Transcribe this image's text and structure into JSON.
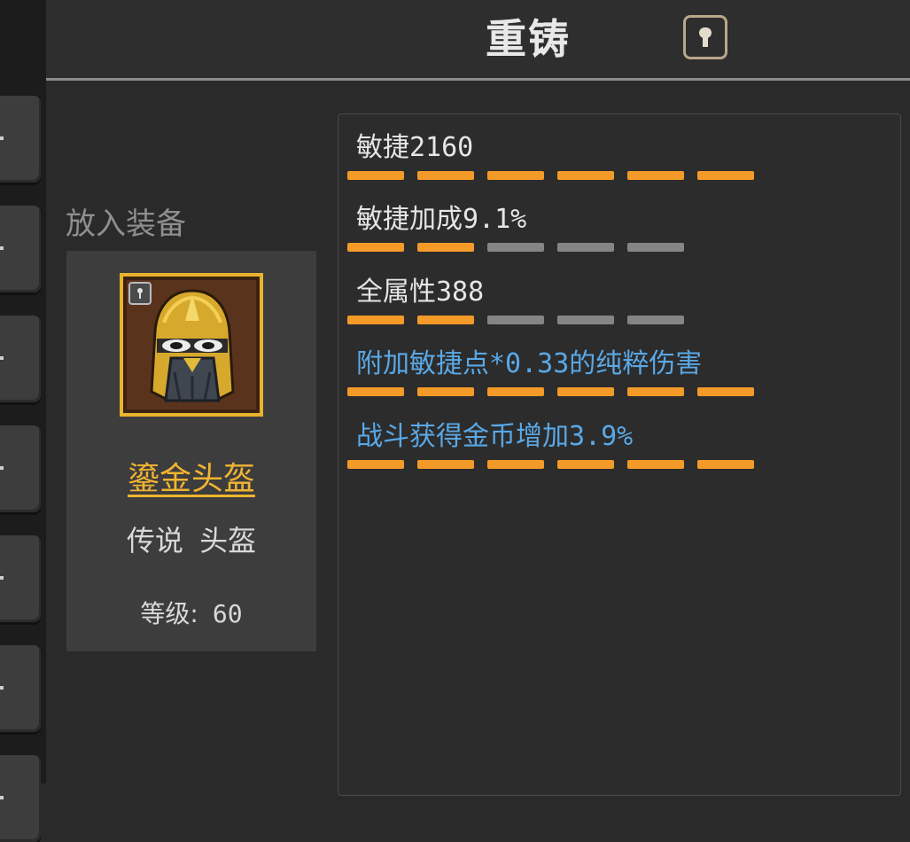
{
  "header": {
    "title": "重铸"
  },
  "slot": {
    "label": "放入装备"
  },
  "item": {
    "name": "鎏金头盔",
    "type": "传说 头盔",
    "level_label": "等级:",
    "level_value": "60"
  },
  "stats": [
    {
      "text": "敏捷2160",
      "special": false,
      "tier_filled": 6,
      "tier_max": 6
    },
    {
      "text": "敏捷加成9.1%",
      "special": false,
      "tier_filled": 2,
      "tier_max": 5
    },
    {
      "text": "全属性388",
      "special": false,
      "tier_filled": 2,
      "tier_max": 5
    },
    {
      "text": "附加敏捷点*0.33的纯粹伤害",
      "special": true,
      "tier_filled": 6,
      "tier_max": 6
    },
    {
      "text": "战斗获得金币增加3.9%",
      "special": true,
      "tier_filled": 6,
      "tier_max": 6
    }
  ],
  "colors": {
    "background": "#2a2a2a",
    "title": "#e8e8e8",
    "item_legendary": "#f0b431",
    "stat_normal": "#e6e6e6",
    "stat_special": "#5aa8e6",
    "tier_on": "#f39a28",
    "tier_off": "#858585"
  },
  "icons": {
    "help": "keyhole-icon",
    "lock": "lock-icon",
    "item": "golden-helmet-icon"
  }
}
